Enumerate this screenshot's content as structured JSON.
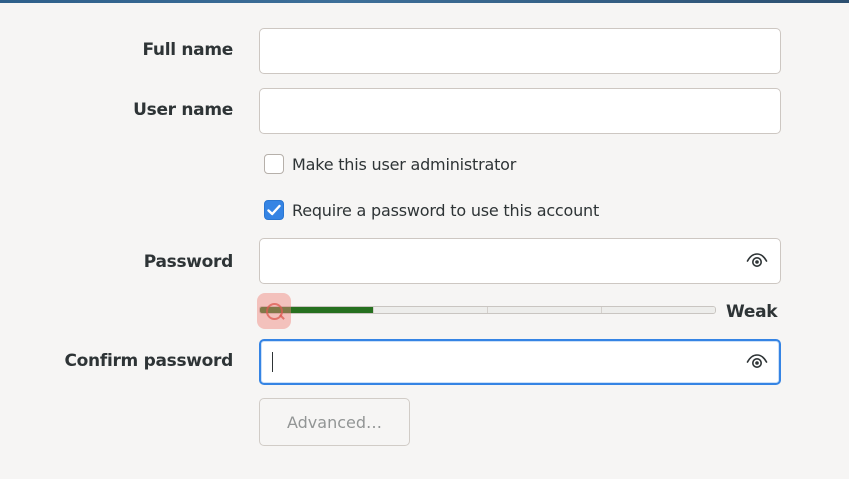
{
  "form": {
    "full_name": {
      "label": "Full name",
      "value": ""
    },
    "user_name": {
      "label": "User name",
      "value": ""
    },
    "admin_checkbox": {
      "label": "Make this user administrator",
      "checked": false
    },
    "require_password_checkbox": {
      "label": "Require a password to use this account",
      "checked": true
    },
    "password": {
      "label": "Password",
      "value": "",
      "icon": "eye-icon"
    },
    "strength": {
      "label": "Weak",
      "level": 0.25,
      "segments": 4,
      "fill_color": "#26701f"
    },
    "confirm_password": {
      "label": "Confirm password",
      "value": "",
      "icon": "eye-icon",
      "focused": true
    },
    "advanced_button": {
      "label": "Advanced…",
      "enabled": false
    }
  },
  "colors": {
    "accent": "#3584e4",
    "background": "#f6f5f4",
    "text": "#2e3436"
  }
}
